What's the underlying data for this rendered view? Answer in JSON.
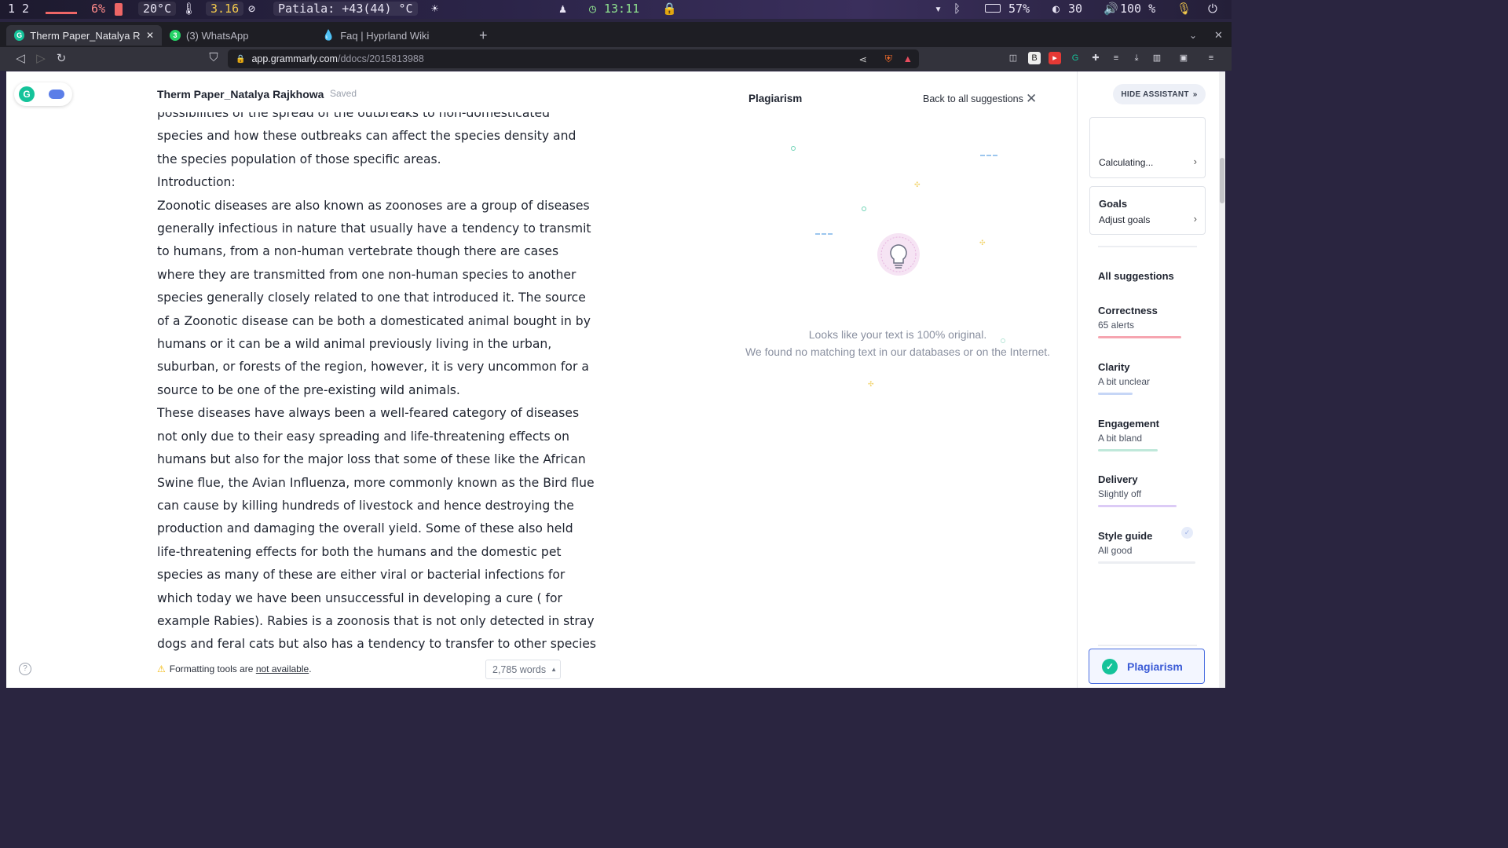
{
  "system_bar": {
    "workspaces": "1 2",
    "cpu": "6%",
    "temperature": "20°C",
    "load": "3.16",
    "weather": "Patiala: +43(44) °C",
    "clock": "13:11",
    "battery": "57%",
    "brightness": "30",
    "volume": "100 %"
  },
  "browser": {
    "tabs": [
      {
        "label": "Therm Paper_Natalya Rajk",
        "active": true
      },
      {
        "label": "(3) WhatsApp",
        "active": false
      },
      {
        "label": "Faq | Hyprland Wiki",
        "active": false
      }
    ],
    "url_domain": "app.grammarly.com",
    "url_path": "/ddocs/2015813988"
  },
  "document": {
    "title": "Therm Paper_Natalya Rajkhowa",
    "status": "Saved",
    "paragraphs": [
      "possibilities of the spread of the outbreaks to non-domesticated species and how these outbreaks can affect the species density and the species population of those specific areas.",
      "Introduction:",
      "Zoonotic diseases are also known as zoonoses are a group of diseases generally infectious in nature that usually have a tendency to transmit to humans, from a non-human vertebrate though there are cases where they are transmitted from one non-human species to another species generally closely related to one that introduced it. The source of a Zoonotic disease can be both a domesticated animal bought in by humans or it can be a wild animal previously living in the urban, suburban, or forests of the region, however, it is very uncommon for a source to be one of the pre-existing wild animals.",
      "These diseases have always been a well-feared category of diseases not only due to their easy spreading and life-threatening effects on humans but also for the major loss that some of these like the African Swine flue, the Avian Influenza, more commonly known as the Bird flue can cause by killing hundreds of livestock and hence destroying the production and damaging the overall yield. Some of these also held life-threatening effects for both the humans and the domestic pet species as many of these are either viral or bacterial infections for which today we have been unsuccessful in developing a cure ( for example Rabies). Rabies is a zoonosis that is not only detected in stray dogs and feral cats but also has a tendency to transfer to other species of animals included including"
    ],
    "footer_prefix": "Formatting tools are ",
    "footer_link": "not available",
    "footer_suffix": ".",
    "word_count": "2,785 words"
  },
  "plagiarism": {
    "title": "Plagiarism",
    "back_label": "Back to all suggestions",
    "message_line1": "Looks like your text is 100% original.",
    "message_line2": "We found no matching text in our databases or on the Internet."
  },
  "sidebar": {
    "hide_label": "HIDE ASSISTANT",
    "score_status": "Calculating...",
    "goals_title": "Goals",
    "goals_sub": "Adjust goals",
    "all_suggestions": "All suggestions",
    "categories": [
      {
        "title": "Correctness",
        "sub": "65 alerts",
        "color": "#f27b8a"
      },
      {
        "title": "Clarity",
        "sub": "A bit unclear",
        "color": "#7ea3f0"
      },
      {
        "title": "Engagement",
        "sub": "A bit bland",
        "color": "#5fc9a6"
      },
      {
        "title": "Delivery",
        "sub": "Slightly off",
        "color": "#b48cf0"
      },
      {
        "title": "Style guide",
        "sub": "All good",
        "color": "#d8dbe2"
      }
    ],
    "plagiarism_button": "Plagiarism"
  },
  "colors": {
    "accent": "#4a6ee0",
    "grammarly_green": "#15c39a"
  }
}
